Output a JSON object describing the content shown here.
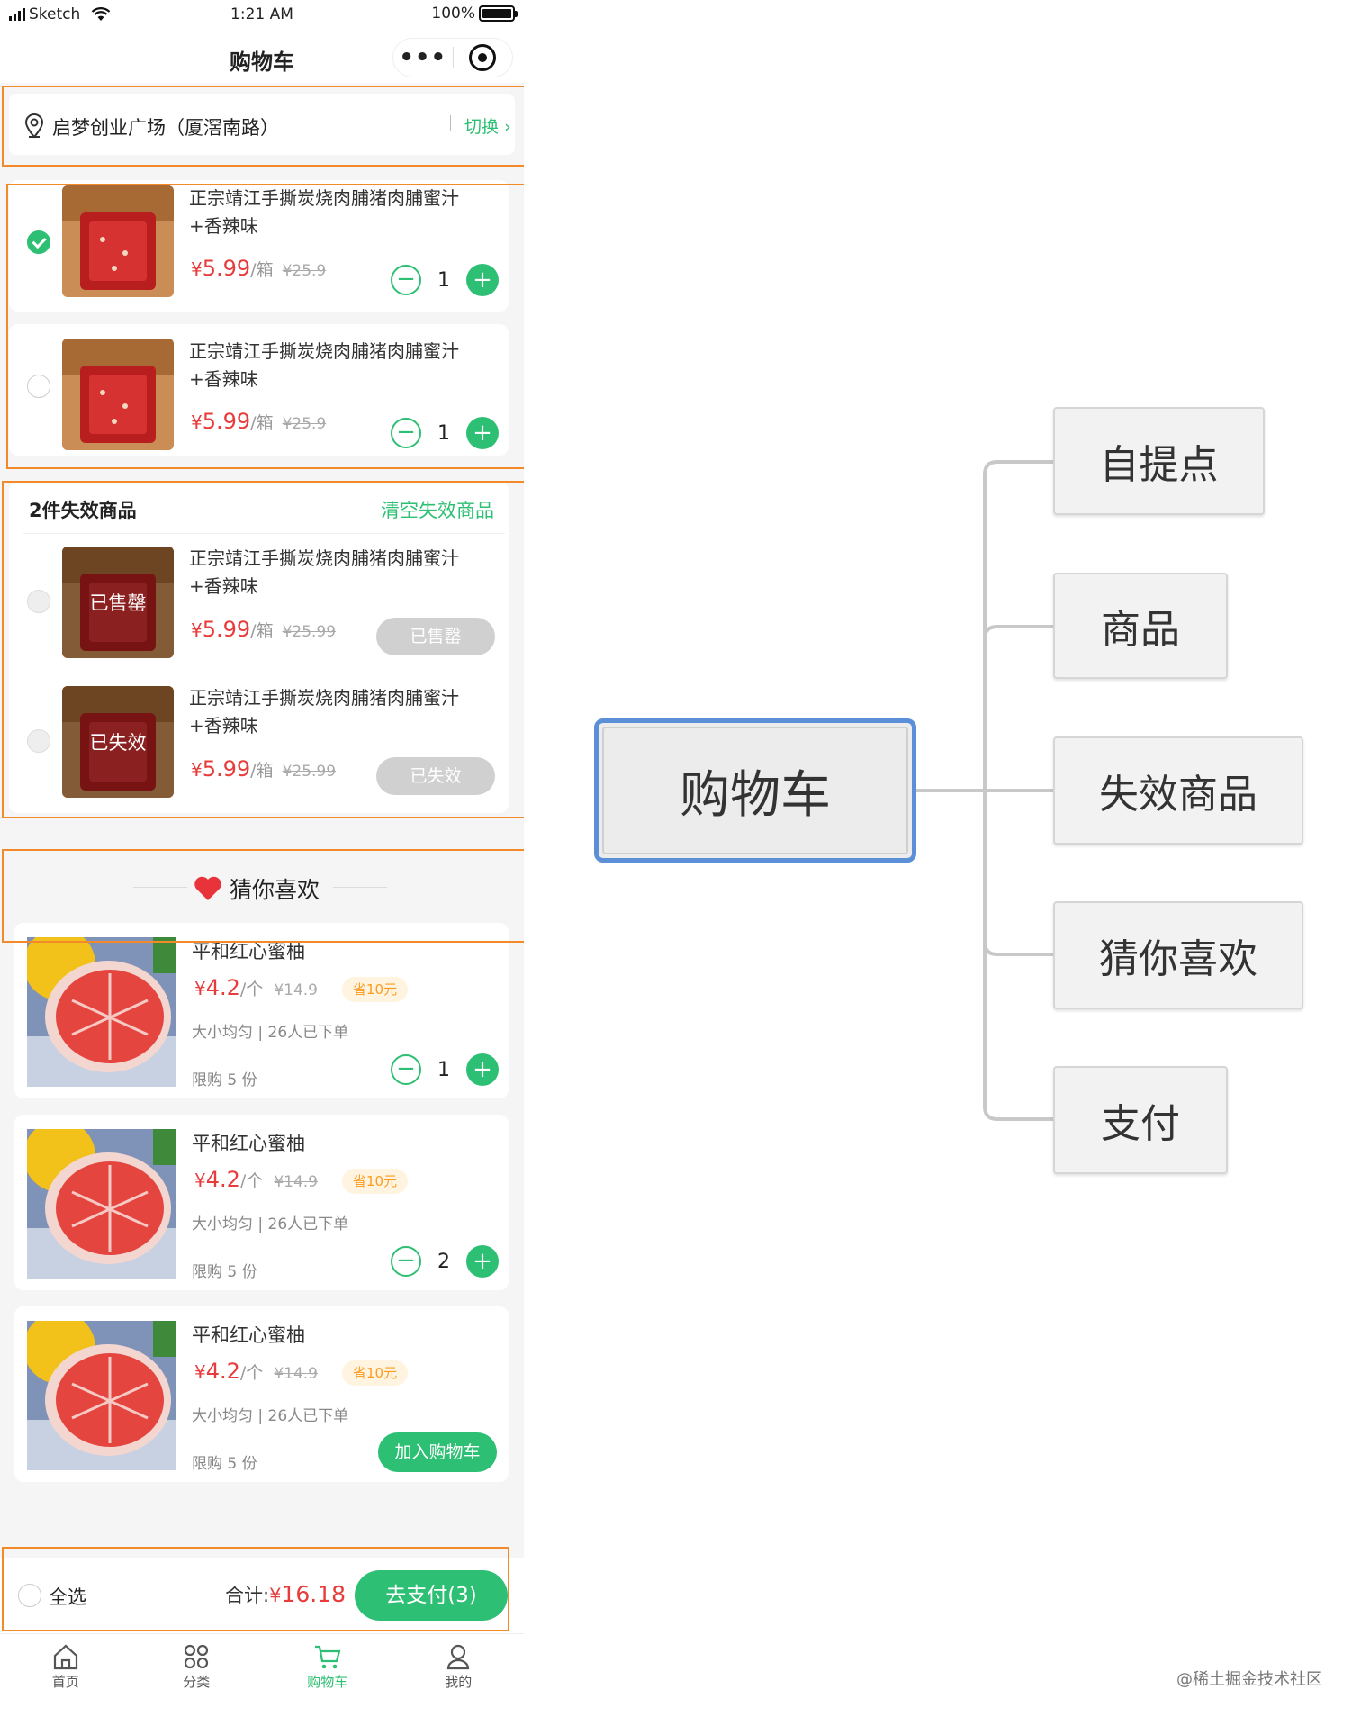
{
  "status_bar": {
    "carrier": "Sketch",
    "time": "1:21 AM",
    "battery": "100%"
  },
  "nav": {
    "title": "购物车"
  },
  "address": {
    "text": "启梦创业广场（厦滘南路）",
    "switch": "切换"
  },
  "cart_items": [
    {
      "name_line1": "正宗靖江手撕炭烧肉脯猪肉脯蜜汁",
      "name_line2": "+香辣味",
      "currency": "¥",
      "price": "5.99",
      "unit": "/箱",
      "old_price": "¥25.9",
      "qty": "1",
      "checked": true
    },
    {
      "name_line1": "正宗靖江手撕炭烧肉脯猪肉脯蜜汁",
      "name_line2": "+香辣味",
      "currency": "¥",
      "price": "5.99",
      "unit": "/箱",
      "old_price": "¥25.9",
      "qty": "1",
      "checked": false
    }
  ],
  "invalid": {
    "header": "2件失效商品",
    "clear": "清空失效商品",
    "items": [
      {
        "name_line1": "正宗靖江手撕炭烧肉脯猪肉脯蜜汁",
        "name_line2": "+香辣味",
        "currency": "¥",
        "price": "5.99",
        "unit": "/箱",
        "old_price": "¥25.99",
        "overlay": "已售罄",
        "status": "已售罄"
      },
      {
        "name_line1": "正宗靖江手撕炭烧肉脯猪肉脯蜜汁",
        "name_line2": "+香辣味",
        "currency": "¥",
        "price": "5.99",
        "unit": "/箱",
        "old_price": "¥25.99",
        "overlay": "已失效",
        "status": "已失效"
      }
    ]
  },
  "guess": {
    "title": "猜你喜欢"
  },
  "recommend": [
    {
      "name": "平和红心蜜柚",
      "currency": "¥",
      "price": "4.2",
      "unit": "/个",
      "old_price": "¥14.9",
      "save": "省10元",
      "meta_a": "大小均匀",
      "meta_sep": "|",
      "meta_b": "26人已下单",
      "limit": "限购 5 份",
      "qty": "1"
    },
    {
      "name": "平和红心蜜柚",
      "currency": "¥",
      "price": "4.2",
      "unit": "/个",
      "old_price": "¥14.9",
      "save": "省10元",
      "meta_a": "大小均匀",
      "meta_sep": "|",
      "meta_b": "26人已下单",
      "limit": "限购 5 份",
      "qty": "2"
    },
    {
      "name": "平和红心蜜柚",
      "currency": "¥",
      "price": "4.2",
      "unit": "/个",
      "old_price": "¥14.9",
      "save": "省10元",
      "meta_a": "大小均匀",
      "meta_sep": "|",
      "meta_b": "26人已下单",
      "limit": "限购 5 份",
      "button": "加入购物车"
    }
  ],
  "footer": {
    "select_all": "全选",
    "total_label": "合计:",
    "currency": "¥",
    "total": "16.18",
    "pay": "去支付(3)"
  },
  "tabbar": [
    {
      "label": "首页",
      "icon": "home-icon",
      "active": false
    },
    {
      "label": "分类",
      "icon": "category-icon",
      "active": false
    },
    {
      "label": "购物车",
      "icon": "cart-icon",
      "active": true
    },
    {
      "label": "我的",
      "icon": "profile-icon",
      "active": false
    }
  ],
  "mindmap": {
    "root": "购物车",
    "children": [
      "自提点",
      "商品",
      "失效商品",
      "猜你喜欢",
      "支付"
    ]
  },
  "watermark": "@稀土掘金技术社区",
  "colors": {
    "accent_green": "#2dbf73",
    "price_red": "#e83c3c",
    "highlight_orange": "#f28a2a",
    "root_border_blue": "#5b8fd8"
  }
}
